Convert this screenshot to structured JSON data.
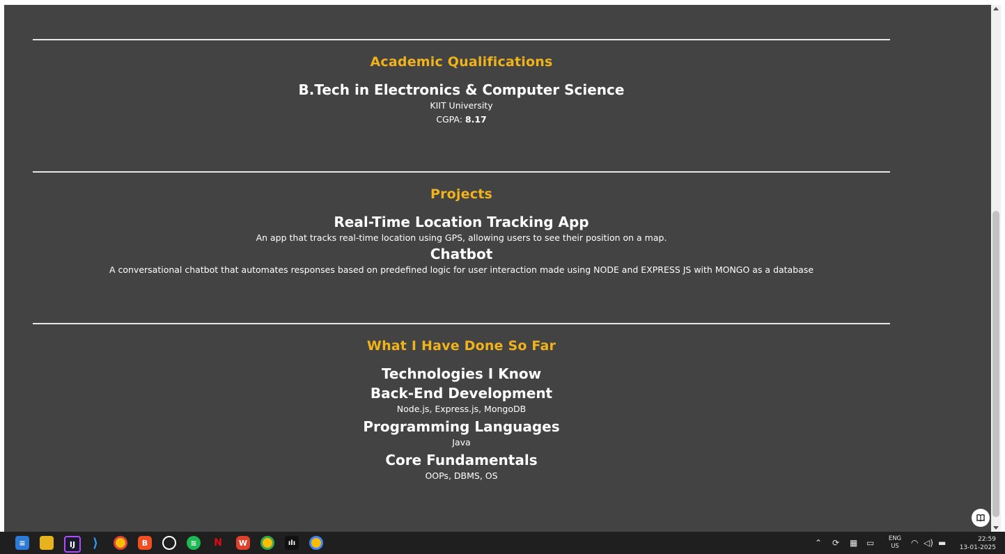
{
  "academic": {
    "heading": "Academic Qualifications",
    "degree": "B.Tech in Electronics & Computer Science",
    "university": "KIIT University",
    "cgpa_label": "CGPA: ",
    "cgpa_value": "8.17"
  },
  "projects": {
    "heading": "Projects",
    "items": [
      {
        "title": "Real-Time Location Tracking App",
        "description": "An app that tracks real-time location using GPS, allowing users to see their position on a map."
      },
      {
        "title": "Chatbot",
        "description": "A conversational chatbot that automates responses based on predefined logic for user interaction made using NODE and EXPRESS JS with MONGO as a database"
      }
    ]
  },
  "done_so_far": {
    "heading": "What I Have Done So Far",
    "subheading": "Technologies I Know",
    "groups": [
      {
        "title": "Back-End Development",
        "items": "Node.js, Express.js, MongoDB"
      },
      {
        "title": "Programming Languages",
        "items": "Java"
      },
      {
        "title": "Core Fundamentals",
        "items": "OOPs, DBMS, OS"
      }
    ]
  },
  "taskbar": {
    "apps": [
      "notepad-icon",
      "file-explorer-icon",
      "intellij-icon",
      "vscode-icon",
      "chrome-icon",
      "brave-icon",
      "whatsapp-icon",
      "spotify-icon",
      "netflix-icon",
      "wps-office-icon",
      "chrome-profile-icon",
      "audio-visualizer-icon",
      "chrome-profile-2-icon"
    ],
    "language": "ENG",
    "region": "US",
    "time": "22:59",
    "date": "13-01-2025"
  },
  "colors": {
    "page_bg": "#444343",
    "heading_accent": "#f0b41a",
    "taskbar_bg": "#1f1f1f"
  }
}
